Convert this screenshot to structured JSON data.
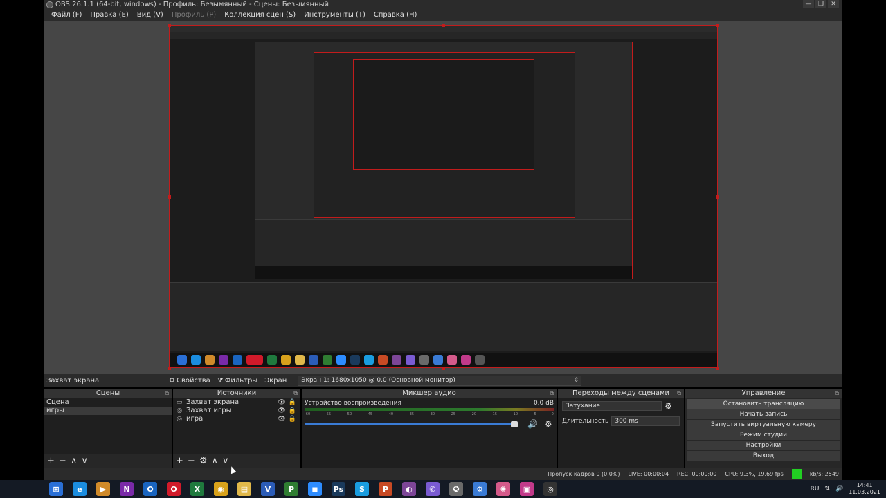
{
  "window": {
    "title": "OBS 26.1.1 (64-bit, windows) - Профиль: Безымянный - Сцены: Безымянный",
    "minimize": "—",
    "maximize": "❐",
    "close": "✕"
  },
  "menu": {
    "file": "Файл (F)",
    "edit": "Правка (E)",
    "view": "Вид (V)",
    "profile": "Профиль (P)",
    "collection": "Коллекция сцен (S)",
    "tools": "Инструменты (T)",
    "help": "Справка (H)"
  },
  "source_toolbar": {
    "selected_source": "Захват экрана",
    "properties": "Свойства",
    "filters": "Фильтры",
    "display_label": "Экран",
    "display_value": "Экран 1: 1680x1050 @ 0,0 (Основной монитор)"
  },
  "scenes": {
    "title": "Сцены",
    "items": [
      "Сцена",
      "игры"
    ],
    "foot": {
      "add": "+",
      "remove": "−",
      "up": "∧",
      "down": "∨"
    }
  },
  "sources": {
    "title": "Источники",
    "items": [
      {
        "label": "Захват экрана",
        "icon": "monitor-icon"
      },
      {
        "label": "Захват игры",
        "icon": "gamepad-icon"
      },
      {
        "label": "игра",
        "icon": "gamepad-icon"
      }
    ],
    "foot": {
      "add": "+",
      "remove": "−",
      "settings": "⚙",
      "up": "∧",
      "down": "∨"
    }
  },
  "mixer": {
    "title": "Микшер аудио",
    "device": "Устройство воспроизведения",
    "level": "0.0 dB",
    "ticks": [
      "-60",
      "-55",
      "-50",
      "-45",
      "-40",
      "-35",
      "-30",
      "-25",
      "-20",
      "-15",
      "-10",
      "-5",
      "0"
    ]
  },
  "transitions": {
    "title": "Переходы между сценами",
    "selected": "Затухание",
    "duration_label": "Длительность",
    "duration_value": "300 ms"
  },
  "controls": {
    "title": "Управление",
    "buttons": [
      "Остановить трансляцию",
      "Начать запись",
      "Запустить виртуальную камеру",
      "Режим студии",
      "Настройки",
      "Выход"
    ]
  },
  "status": {
    "dropped": "Пропуск кадров 0 (0.0%)",
    "live": "LIVE: 00:00:04",
    "rec": "REC: 00:00:00",
    "cpu": "CPU: 9.3%, 19.69 fps",
    "kbps": "kb/s: 2549",
    "indicator_color": "#22d022"
  },
  "taskbar": {
    "lang": "RU",
    "time": "14:41",
    "date": "11.03.2021",
    "apps": [
      {
        "name": "start-button-icon",
        "glyph": "⊞",
        "color": "#2a6fd6"
      },
      {
        "name": "ie-icon",
        "glyph": "e",
        "color": "#1b8de0"
      },
      {
        "name": "media-player-icon",
        "glyph": "▶",
        "color": "#d08a2a"
      },
      {
        "name": "onenote-icon",
        "glyph": "N",
        "color": "#7a2aa8"
      },
      {
        "name": "outlook-icon",
        "glyph": "O",
        "color": "#1a65c0"
      },
      {
        "name": "opera-icon",
        "glyph": "O",
        "color": "#d11a2a"
      },
      {
        "name": "excel-icon",
        "glyph": "X",
        "color": "#1f7a3e"
      },
      {
        "name": "chrome-icon",
        "glyph": "◉",
        "color": "#d8a21c"
      },
      {
        "name": "explorer-icon",
        "glyph": "▤",
        "color": "#e0b84a"
      },
      {
        "name": "visio-icon",
        "glyph": "V",
        "color": "#2b5cb8"
      },
      {
        "name": "project-icon",
        "glyph": "P",
        "color": "#2f7d32"
      },
      {
        "name": "zoom-icon",
        "glyph": "◼",
        "color": "#2d8cff"
      },
      {
        "name": "photoshop-icon",
        "glyph": "Ps",
        "color": "#1a3a5c"
      },
      {
        "name": "skype-icon",
        "glyph": "S",
        "color": "#1a9de0"
      },
      {
        "name": "powerpoint-icon",
        "glyph": "P",
        "color": "#c84a24"
      },
      {
        "name": "tor-icon",
        "glyph": "◐",
        "color": "#7d4698"
      },
      {
        "name": "viber-icon",
        "glyph": "✆",
        "color": "#7a5bd2"
      },
      {
        "name": "settings-app-icon",
        "glyph": "✪",
        "color": "#6a6a6a"
      },
      {
        "name": "steam-icon",
        "glyph": "⚙",
        "color": "#3a7bd5"
      },
      {
        "name": "color-app-icon",
        "glyph": "✺",
        "color": "#d45a8a"
      },
      {
        "name": "gallery-icon",
        "glyph": "▣",
        "color": "#c23a8a"
      },
      {
        "name": "obs-taskbar-icon",
        "glyph": "◎",
        "color": "#333333"
      }
    ]
  }
}
